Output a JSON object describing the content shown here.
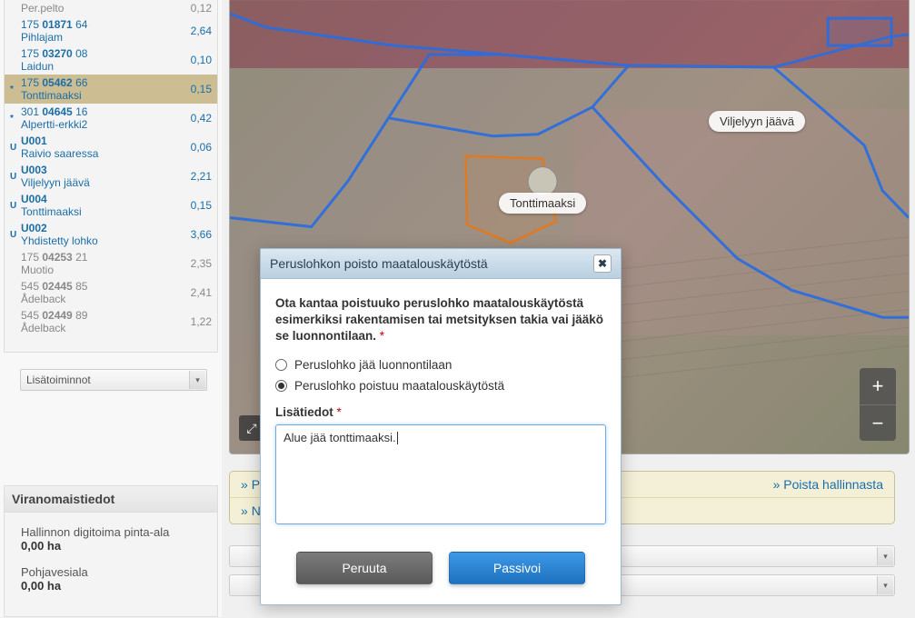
{
  "list": {
    "rows": [
      {
        "tag": "",
        "line1": "",
        "line2": "Per.pelto",
        "area": "0,12",
        "cls": "grey"
      },
      {
        "tag": "",
        "line1": "175 01871 64",
        "line2": "Pihlajam",
        "area": "2,64",
        "cls": ""
      },
      {
        "tag": "",
        "line1": "175 03270 08",
        "line2": "Laidun",
        "area": "0,10",
        "cls": ""
      },
      {
        "tag": "*",
        "line1": "175 05462 66",
        "line2": "Tonttimaaksi",
        "area": "0,15",
        "cls": "highlight"
      },
      {
        "tag": "*",
        "line1": "301 04645 16",
        "line2": "Alpertti-erkki2",
        "area": "0,42",
        "cls": ""
      },
      {
        "tag": "U",
        "line1": "U001",
        "line2": "Raivio saaressa",
        "area": "0,06",
        "cls": ""
      },
      {
        "tag": "U",
        "line1": "U003",
        "line2": "Viljelyyn jäävä",
        "area": "2,21",
        "cls": ""
      },
      {
        "tag": "U",
        "line1": "U004",
        "line2": "Tonttimaaksi",
        "area": "0,15",
        "cls": ""
      },
      {
        "tag": "U",
        "line1": "U002",
        "line2": "Yhdistetty lohko",
        "area": "3,66",
        "cls": ""
      },
      {
        "tag": "",
        "line1": "175 04253 21",
        "line2": "Muotio",
        "area": "2,35",
        "cls": "grey"
      },
      {
        "tag": "",
        "line1": "545 02445 85",
        "line2": "Ådelback",
        "area": "2,41",
        "cls": "grey"
      },
      {
        "tag": "",
        "line1": "545 02449 89",
        "line2": "Ådelback",
        "area": "1,22",
        "cls": "grey"
      }
    ],
    "dropdown_label": "Lisätoiminnot"
  },
  "viranomaistiedot": {
    "title": "Viranomaistiedot",
    "rows": [
      {
        "label": "Hallinnon digitoima pinta-ala",
        "value": "0,00 ha"
      },
      {
        "label": "Pohjavesiala",
        "value": "0,00 ha"
      }
    ]
  },
  "map": {
    "labels": {
      "viljelyyn": "Viljelyyn jäävä",
      "tonttimaaksi": "Tonttimaaksi"
    },
    "zoom_in": "+",
    "zoom_out": "−",
    "fullscreen": "⤢"
  },
  "under_map": {
    "row1_left": "Piilo",
    "row1_right": "Poista hallinnasta",
    "row2_left": "Ni"
  },
  "modal": {
    "title": "Peruslohkon poisto maatalouskäytöstä",
    "prompt": "Ota kantaa poistuuko peruslohko maatalouskäytöstä esimerkiksi rakentamisen tai metsityksen takia vai jääkö se luonnontilaan.",
    "star": "*",
    "radio1": "Peruslohko jää luonnontilaan",
    "radio2": "Peruslohko poistuu maatalouskäytöstä",
    "additional_label": "Lisätiedot",
    "additional_value": "Alue jää tonttimaaksi.",
    "cancel": "Peruuta",
    "confirm": "Passivoi",
    "selected_radio": 2
  }
}
